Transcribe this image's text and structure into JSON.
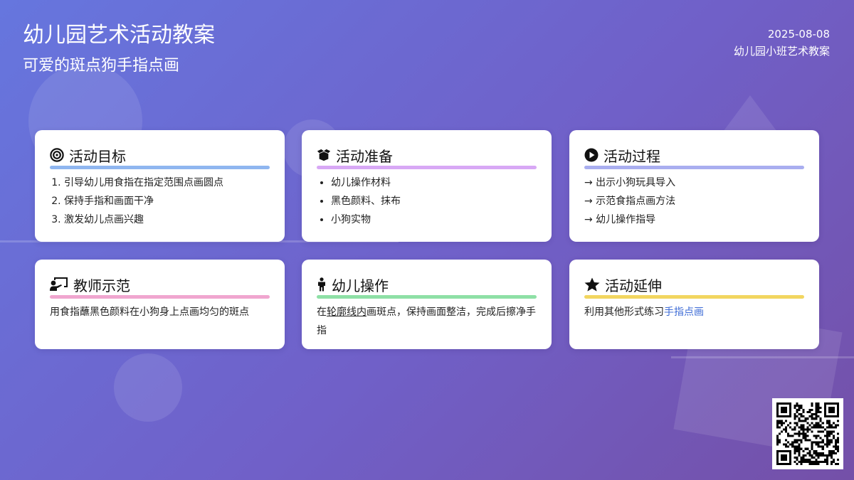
{
  "header": {
    "title": "幼儿园艺术活动教案",
    "subtitle": "可爱的斑点狗手指点画",
    "date": "2025-08-08",
    "class_info": "幼儿园小班艺术教案"
  },
  "cards": [
    {
      "title": "活动目标",
      "icon": "bullseye-icon",
      "bar_color": "#8fb6f0",
      "items": [
        "引导幼儿用食指在指定范围点画圆点",
        "保持手指和画面干净",
        "激发幼儿点画兴趣"
      ]
    },
    {
      "title": "活动准备",
      "icon": "box-open-icon",
      "bar_color": "#d8a8f5",
      "items": [
        "幼儿操作材料",
        "黑色颜料、抹布",
        "小狗实物"
      ]
    },
    {
      "title": "活动过程",
      "icon": "play-circle-icon",
      "bar_color": "#a9aef0",
      "items": [
        "→ 出示小狗玩具导入",
        "→ 示范食指点画方法",
        "→ 幼儿操作指导"
      ]
    },
    {
      "title": "教师示范",
      "icon": "chalkboard-teacher-icon",
      "bar_color": "#f0a6cf",
      "text": "用食指蘸黑色颜料在小狗身上点画均匀的斑点"
    },
    {
      "title": "幼儿操作",
      "icon": "child-icon",
      "bar_color": "#8ee0a6",
      "text_prefix": "在",
      "text_underlined": "轮廓线内",
      "text_suffix": "画斑点，保持画面整洁，完成后擦净手指"
    },
    {
      "title": "活动延伸",
      "icon": "star-icon",
      "bar_color": "#f2d660",
      "text_prefix": "利用其他形式练习",
      "text_link": "手指点画"
    }
  ],
  "qr": {
    "icon": "qr-code-icon"
  }
}
